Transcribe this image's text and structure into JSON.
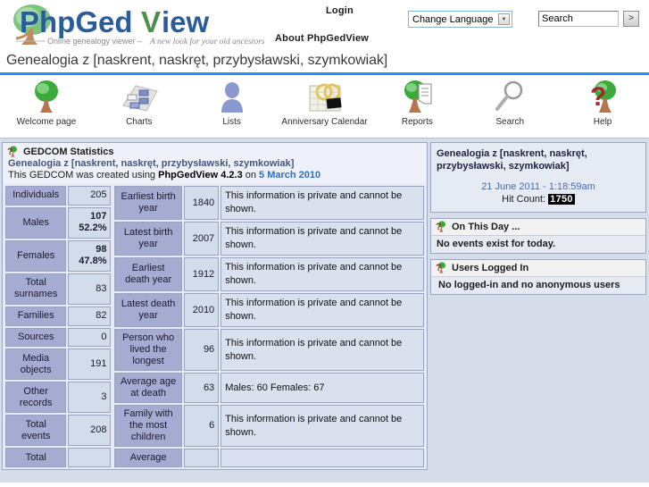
{
  "header": {
    "logo_text": "PhpGedView",
    "logo_tagline": "Online genealogy viewer – A new look for your old ancestors",
    "login_label": "Login",
    "about_label": "About PhpGedView",
    "language_selected": "Change Language",
    "search_value": "Search",
    "search_go_label": ">"
  },
  "page_title": "Genealogia z [naskrent, naskręt, przybysławski, szymkowiak]",
  "nav": [
    {
      "label": "Welcome page",
      "icon": "tree-icon"
    },
    {
      "label": "Charts",
      "icon": "chart-icon"
    },
    {
      "label": "Lists",
      "icon": "person-icon"
    },
    {
      "label": "Anniversary Calendar",
      "icon": "calendar-icon"
    },
    {
      "label": "Reports",
      "icon": "report-icon"
    },
    {
      "label": "Search",
      "icon": "magnifier-icon"
    },
    {
      "label": "Help",
      "icon": "help-icon"
    }
  ],
  "gedcom": {
    "icon": "help-book-icon",
    "title": "GEDCOM Statistics",
    "subtitle": "Genealogia z [naskrent, naskręt, przybysławski, szymkowiak]",
    "created_prefix": "This GEDCOM was created using ",
    "created_version": "PhpGedView 4.2.3",
    "created_on": " on ",
    "created_date": "5 March 2010"
  },
  "stats_col1": [
    {
      "label": "Individuals",
      "value": "205",
      "bold": false
    },
    {
      "label": "Males",
      "value": "107",
      "value2": "52.2%",
      "bold": true
    },
    {
      "label": "Females",
      "value": "98",
      "value2": "47.8%",
      "bold": true
    },
    {
      "label": "Total surnames",
      "value": "83",
      "bold": false
    },
    {
      "label": "Families",
      "value": "82",
      "bold": false
    },
    {
      "label": "Sources",
      "value": "0",
      "bold": false
    },
    {
      "label": "Media objects",
      "value": "191",
      "bold": false
    },
    {
      "label": "Other records",
      "value": "3",
      "bold": false
    },
    {
      "label": "Total events",
      "value": "208",
      "bold": false
    },
    {
      "label": "Total",
      "value": "",
      "bold": false
    }
  ],
  "stats_col2": [
    {
      "label": "Earliest birth year",
      "value": "1840",
      "note": "This information is private and cannot be shown."
    },
    {
      "label": "Latest birth year",
      "value": "2007",
      "note": "This information is private and cannot be shown."
    },
    {
      "label": "Earliest death year",
      "value": "1912",
      "note": "This information is private and cannot be shown."
    },
    {
      "label": "Latest death year",
      "value": "2010",
      "note": "This information is private and cannot be shown."
    },
    {
      "label": "Person who lived the longest",
      "value": "96",
      "note": "This information is private and cannot be shown."
    },
    {
      "label": "Average age at death",
      "value": "63",
      "note": "Males: 60   Females: 67"
    },
    {
      "label": "Family with the most children",
      "value": "6",
      "note": "This information is private and cannot be shown."
    },
    {
      "label": "Average",
      "value": "",
      "note": ""
    }
  ],
  "sidebar": {
    "welcome": {
      "title": "Genealogia z [naskrent, naskręt, przybysławski, szymkowiak]",
      "date": "21 June 2011 - 1:18:59am",
      "hit_label": "Hit Count:",
      "hit_count": "1750"
    },
    "on_this_day": {
      "icon": "help-book-icon",
      "title": "On This Day ...",
      "body": "No events exist for today."
    },
    "users_logged_in": {
      "icon": "help-book-icon",
      "title": "Users Logged In",
      "body": "No logged-in and no anonymous users"
    }
  },
  "colors": {
    "rule_blue": "#1e90ff",
    "page_bg": "#d5dcea",
    "label_cell": "#a5abd1",
    "value_cell": "#d3dcea",
    "text_cell": "#d9e1ee",
    "logo_blue": "#2a5c9a",
    "logo_green": "#4aab4a"
  }
}
